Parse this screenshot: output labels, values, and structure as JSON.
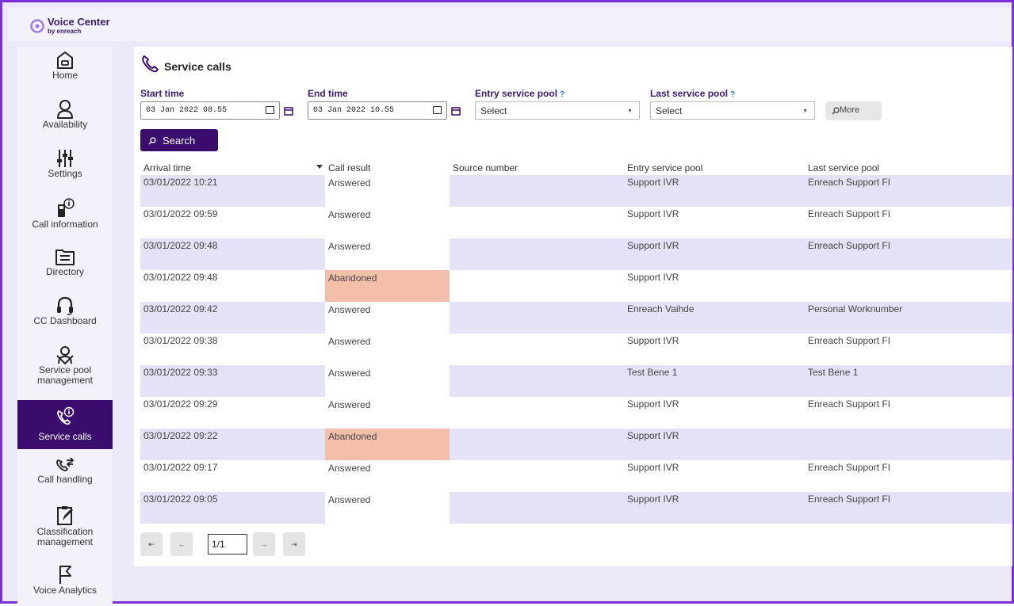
{
  "app": {
    "title": "Voice Center",
    "subtitle": "by enreach"
  },
  "sidebar": {
    "items": [
      {
        "label": "Home",
        "icon": "home-icon"
      },
      {
        "label": "Availability",
        "icon": "person-icon"
      },
      {
        "label": "Settings",
        "icon": "sliders-icon"
      },
      {
        "label": "Call information",
        "icon": "phone-info-icon"
      },
      {
        "label": "Directory",
        "icon": "folder-icon"
      },
      {
        "label": "CC Dashboard",
        "icon": "headset-icon"
      },
      {
        "label": "Service pool management",
        "icon": "group-icon"
      },
      {
        "label": "Service calls",
        "icon": "phone-info-icon",
        "active": true
      },
      {
        "label": "Call handling",
        "icon": "call-transfer-icon"
      },
      {
        "label": "Classification management",
        "icon": "clipboard-icon"
      },
      {
        "label": "Voice Analytics",
        "icon": "flag-icon"
      }
    ]
  },
  "page": {
    "title": "Service calls"
  },
  "filters": {
    "start_label": "Start time",
    "start_value": "03 Jan 2022 08.55",
    "end_label": "End time",
    "end_value": "03 Jan 2022 10.55",
    "entry_pool_label": "Entry service pool",
    "entry_pool_value": "Select",
    "last_pool_label": "Last service pool",
    "last_pool_value": "Select",
    "help_mark": "?",
    "more_label": "More",
    "search_label": "Search"
  },
  "table": {
    "columns": [
      "Arrival time",
      "Call result",
      "Source number",
      "Entry service pool",
      "Last service pool"
    ],
    "rows": [
      {
        "arrival": "03/01/2022 10:21",
        "result": "Answered",
        "source": "",
        "entry": "Support IVR",
        "last": "Enreach Support FI"
      },
      {
        "arrival": "03/01/2022 09:59",
        "result": "Answered",
        "source": "",
        "entry": "Support IVR",
        "last": "Enreach Support FI"
      },
      {
        "arrival": "03/01/2022 09:48",
        "result": "Answered",
        "source": "",
        "entry": "Support IVR",
        "last": "Enreach Support FI"
      },
      {
        "arrival": "03/01/2022 09:48",
        "result": "Abandoned",
        "source": "",
        "entry": "Support IVR",
        "last": ""
      },
      {
        "arrival": "03/01/2022 09:42",
        "result": "Answered",
        "source": "",
        "entry": "Enreach Vaihde",
        "last": "Personal Worknumber"
      },
      {
        "arrival": "03/01/2022 09:38",
        "result": "Answered",
        "source": "",
        "entry": "Support IVR",
        "last": "Enreach Support FI"
      },
      {
        "arrival": "03/01/2022 09:33",
        "result": "Answered",
        "source": "",
        "entry": "Test Bene 1",
        "last": "Test Bene 1"
      },
      {
        "arrival": "03/01/2022 09:29",
        "result": "Answered",
        "source": "",
        "entry": "Support IVR",
        "last": "Enreach Support FI"
      },
      {
        "arrival": "03/01/2022 09:22",
        "result": "Abandoned",
        "source": "",
        "entry": "Support IVR",
        "last": ""
      },
      {
        "arrival": "03/01/2022 09:17",
        "result": "Answered",
        "source": "",
        "entry": "Support IVR",
        "last": "Enreach Support FI"
      },
      {
        "arrival": "03/01/2022 09:05",
        "result": "Answered",
        "source": "",
        "entry": "Support IVR",
        "last": "Enreach Support FI"
      }
    ]
  },
  "pager": {
    "page_value": "1/1"
  },
  "colors": {
    "brand": "#3a0c6e",
    "frame": "#7b2fd4",
    "row_shade": "#e4e2f7",
    "abandoned": "#f4bfaa"
  }
}
